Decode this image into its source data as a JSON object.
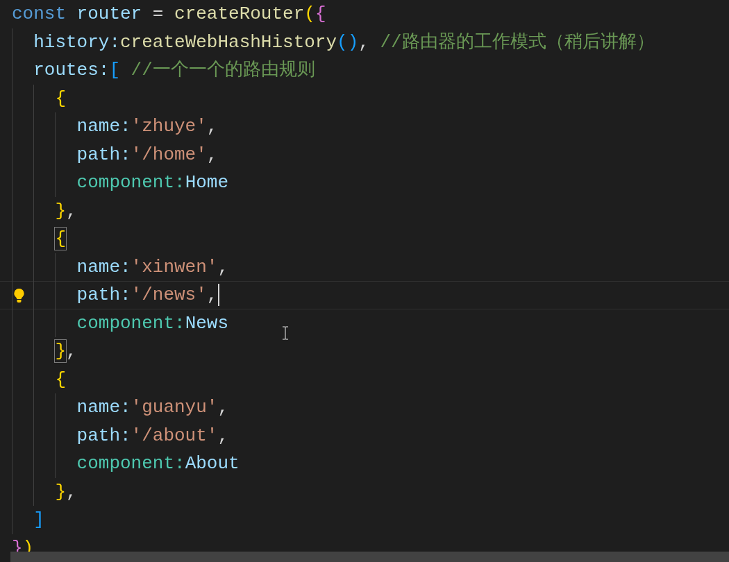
{
  "editor": {
    "lines": [
      {
        "current": false,
        "hint": false,
        "tokens": [
          {
            "text": "const",
            "kind": "keyword"
          },
          {
            "text": "router",
            "kind": "variable"
          },
          {
            "text": "=",
            "kind": "punct"
          },
          {
            "text": "createRouter",
            "kind": "function"
          },
          {
            "text": "(",
            "kind": "bracket1"
          },
          {
            "text": "{",
            "kind": "bracket2"
          }
        ],
        "children": [
          {
            "current": false,
            "hint": false,
            "tokens": [
              {
                "text": "history:",
                "kind": "property"
              },
              {
                "text": "createWebHashHistory",
                "kind": "function"
              },
              {
                "text": "()",
                "kind": "bracket3"
              },
              {
                "text": ", ",
                "kind": "punct"
              },
              {
                "text": "//路由器的工作模式（稍后讲解）",
                "kind": "comment"
              }
            ]
          },
          {
            "current": false,
            "hint": false,
            "tokens": [
              {
                "text": "routes:",
                "kind": "property"
              },
              {
                "text": "[",
                "kind": "bracket3"
              },
              {
                "text": " //一个一个的路由规则",
                "kind": "comment"
              }
            ],
            "children": [
              {
                "current": false,
                "hint": false,
                "tokens": [
                  {
                    "text": "{",
                    "kind": "bracket1"
                  }
                ],
                "children": [
                  {
                    "current": false,
                    "hint": false,
                    "tokens": [
                      {
                        "text": "name:",
                        "kind": "property"
                      },
                      {
                        "text": "'zhuye'",
                        "kind": "string"
                      },
                      {
                        "text": ",",
                        "kind": "punct"
                      }
                    ]
                  },
                  {
                    "current": false,
                    "hint": false,
                    "tokens": [
                      {
                        "text": "path:",
                        "kind": "property"
                      },
                      {
                        "text": "'/home'",
                        "kind": "string"
                      },
                      {
                        "text": ",",
                        "kind": "punct"
                      }
                    ]
                  },
                  {
                    "current": false,
                    "hint": false,
                    "tokens": [
                      {
                        "text": "component:",
                        "kind": "type"
                      },
                      {
                        "text": "Home",
                        "kind": "variable"
                      }
                    ]
                  }
                ]
              },
              {
                "current": false,
                "hint": false,
                "tokens": [
                  {
                    "text": "}",
                    "kind": "bracket1"
                  },
                  {
                    "text": ",",
                    "kind": "punct"
                  }
                ]
              },
              {
                "current": false,
                "hint": false,
                "tokens": [
                  {
                    "text": "{",
                    "kind": "bracket1",
                    "matched": true
                  }
                ],
                "children": [
                  {
                    "current": false,
                    "hint": false,
                    "tokens": [
                      {
                        "text": "name:",
                        "kind": "property"
                      },
                      {
                        "text": "'xinwen'",
                        "kind": "string"
                      },
                      {
                        "text": ",",
                        "kind": "punct"
                      }
                    ]
                  },
                  {
                    "current": true,
                    "hint": true,
                    "tokens": [
                      {
                        "text": "path:",
                        "kind": "property"
                      },
                      {
                        "text": "'/news'",
                        "kind": "string"
                      },
                      {
                        "text": ",",
                        "kind": "punct"
                      }
                    ]
                  },
                  {
                    "current": false,
                    "hint": false,
                    "tokens": [
                      {
                        "text": "component:",
                        "kind": "type"
                      },
                      {
                        "text": "News",
                        "kind": "variable"
                      }
                    ]
                  }
                ]
              },
              {
                "current": false,
                "hint": false,
                "tokens": [
                  {
                    "text": "}",
                    "kind": "bracket1",
                    "matched": true
                  },
                  {
                    "text": ",",
                    "kind": "punct"
                  }
                ]
              },
              {
                "current": false,
                "hint": false,
                "tokens": [
                  {
                    "text": "{",
                    "kind": "bracket1"
                  }
                ],
                "children": [
                  {
                    "current": false,
                    "hint": false,
                    "tokens": [
                      {
                        "text": "name:",
                        "kind": "property"
                      },
                      {
                        "text": "'guanyu'",
                        "kind": "string"
                      },
                      {
                        "text": ",",
                        "kind": "punct"
                      }
                    ]
                  },
                  {
                    "current": false,
                    "hint": false,
                    "tokens": [
                      {
                        "text": "path:",
                        "kind": "property"
                      },
                      {
                        "text": "'/about'",
                        "kind": "string"
                      },
                      {
                        "text": ",",
                        "kind": "punct"
                      }
                    ]
                  },
                  {
                    "current": false,
                    "hint": false,
                    "tokens": [
                      {
                        "text": "component:",
                        "kind": "type"
                      },
                      {
                        "text": "About",
                        "kind": "variable"
                      }
                    ]
                  }
                ]
              },
              {
                "current": false,
                "hint": false,
                "tokens": [
                  {
                    "text": "}",
                    "kind": "bracket1"
                  },
                  {
                    "text": ",",
                    "kind": "punct"
                  }
                ]
              }
            ]
          },
          {
            "current": false,
            "hint": false,
            "tokens": [
              {
                "text": "]",
                "kind": "bracket3"
              }
            ]
          }
        ]
      },
      {
        "current": false,
        "hint": false,
        "tokens": [
          {
            "text": "}",
            "kind": "bracket2"
          },
          {
            "text": ")",
            "kind": "bracket1"
          }
        ]
      }
    ]
  }
}
